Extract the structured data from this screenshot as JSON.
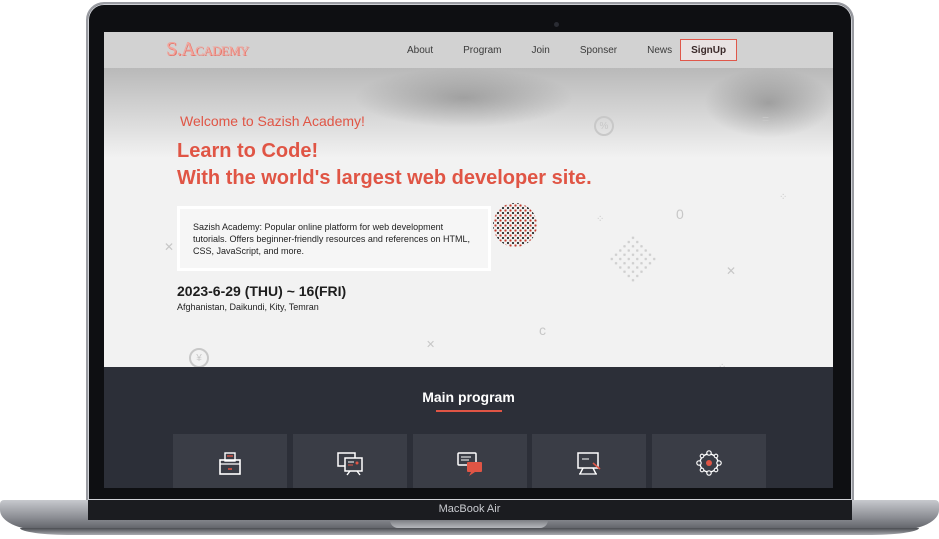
{
  "device": {
    "label": "MacBook Air"
  },
  "navbar": {
    "logo_main": "S.A",
    "logo_small": "CADEMY",
    "links": [
      "About",
      "Program",
      "Join",
      "Sponser",
      "News"
    ],
    "signup_label": "SignUp"
  },
  "hero": {
    "welcome": "Welcome to Sazish Academy!",
    "headline_line1": "Learn to Code!",
    "headline_line2": "With the world's largest web developer site.",
    "description": "Sazish Academy: Popular online platform for web development tutorials. Offers beginner-friendly resources and references on HTML, CSS, JavaScript, and more.",
    "date": "2023-6-29 (THU) ~ 16(FRI)",
    "location": "Afghanistan, Daikundi, Kity, Temran"
  },
  "program": {
    "title": "Main program",
    "cards": [
      {
        "icon": "ballot-box-icon"
      },
      {
        "icon": "presentation-board-icon"
      },
      {
        "icon": "chat-bubbles-icon"
      },
      {
        "icon": "teaching-screen-icon"
      },
      {
        "icon": "network-circle-icon"
      }
    ]
  },
  "colors": {
    "accent": "#e05545",
    "dark_section": "#2c2f38",
    "card": "#3a3d46"
  }
}
